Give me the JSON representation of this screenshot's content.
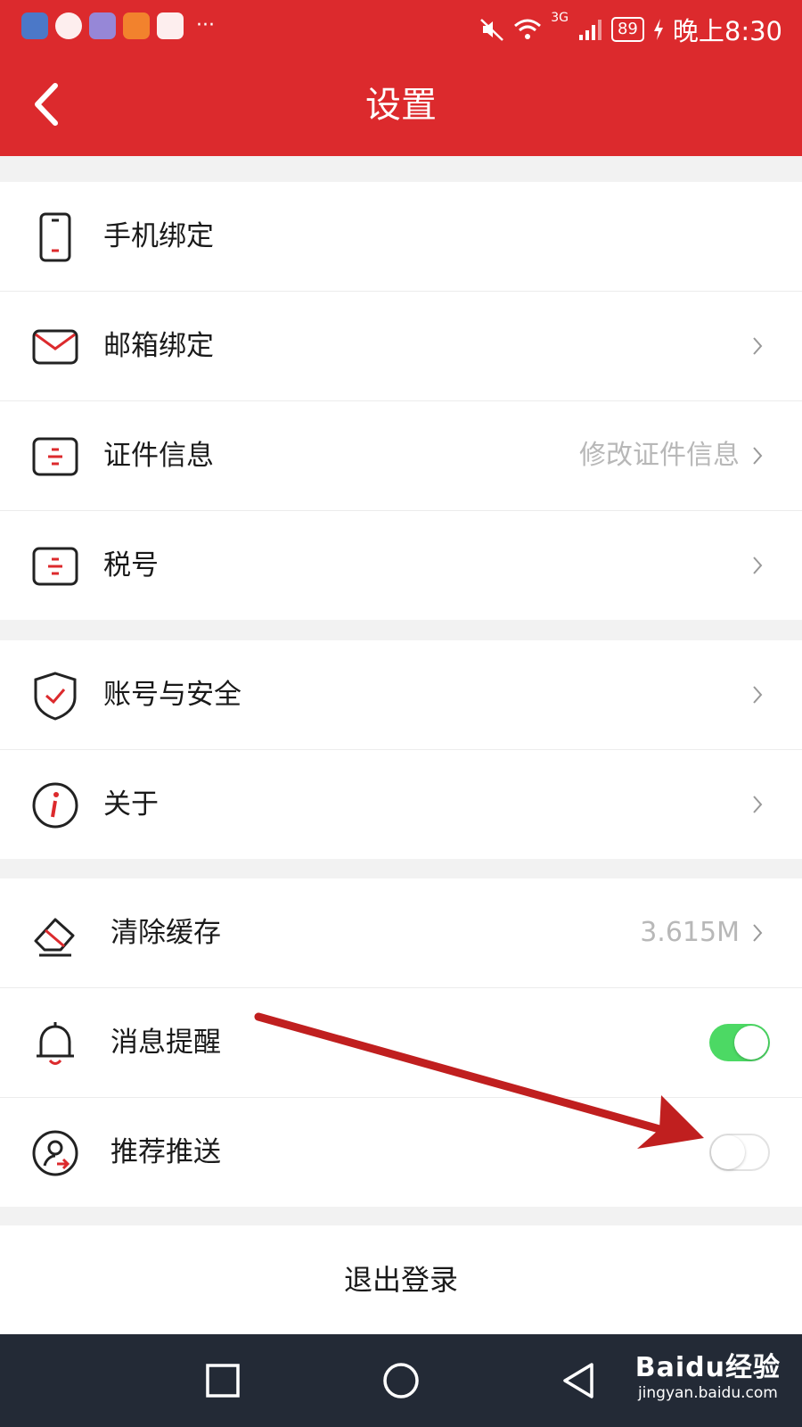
{
  "status_bar": {
    "time": "晚上8:30",
    "battery": "89",
    "network": "3G",
    "more": "···"
  },
  "header": {
    "title": "设置"
  },
  "groups": [
    {
      "items": [
        {
          "label": "手机绑定",
          "value": ""
        },
        {
          "label": "邮箱绑定",
          "value": ""
        },
        {
          "label": "证件信息",
          "value": "修改证件信息"
        },
        {
          "label": "税号",
          "value": ""
        }
      ]
    },
    {
      "items": [
        {
          "label": "账号与安全",
          "value": ""
        },
        {
          "label": "关于",
          "value": ""
        }
      ]
    },
    {
      "items": [
        {
          "label": "清除缓存",
          "value": "3.615M"
        },
        {
          "label": "消息提醒",
          "toggle": true
        },
        {
          "label": "推荐推送",
          "toggle": false
        }
      ]
    }
  ],
  "logout": {
    "label": "退出登录"
  },
  "watermark": {
    "brand": "Baidu经验",
    "url": "jingyan.baidu.com"
  },
  "colors": {
    "brand": "#dc2a2d",
    "toggle_on": "#4cd964",
    "nav_bg": "#232a36",
    "arrow": "#c01f1f"
  },
  "icons": [
    "phone-icon",
    "mail-icon",
    "id-card-icon",
    "tax-card-icon",
    "shield-check-icon",
    "info-icon",
    "eraser-icon",
    "bell-icon",
    "user-push-icon"
  ]
}
